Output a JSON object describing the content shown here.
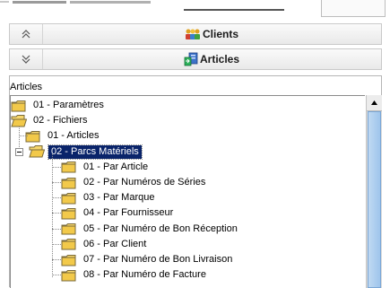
{
  "sections": [
    {
      "label": "Clients",
      "chevron": "up"
    },
    {
      "label": "Articles",
      "chevron": "down"
    }
  ],
  "panel": {
    "title": "Articles"
  },
  "tree": [
    {
      "label": "01 - Paramètres",
      "level": 0,
      "open": false
    },
    {
      "label": "02 - Fichiers",
      "level": 0,
      "open": true
    },
    {
      "label": "01 - Articles",
      "level": 1,
      "open": false
    },
    {
      "label": "02 - Parcs Matériels",
      "level": 1,
      "open": true,
      "selected": true
    },
    {
      "label": "01 - Par Article",
      "level": 2
    },
    {
      "label": "02 - Par Numéros de Séries",
      "level": 2
    },
    {
      "label": "03 - Par Marque",
      "level": 2
    },
    {
      "label": "04 - Par Fournisseur",
      "level": 2
    },
    {
      "label": "05 - Par Numéro de Bon Réception",
      "level": 2
    },
    {
      "label": "06 - Par Client",
      "level": 2
    },
    {
      "label": "07 - Par Numéro de Bon Livraison",
      "level": 2
    },
    {
      "label": "08 - Par Numéro de Facture",
      "level": 2
    }
  ]
}
